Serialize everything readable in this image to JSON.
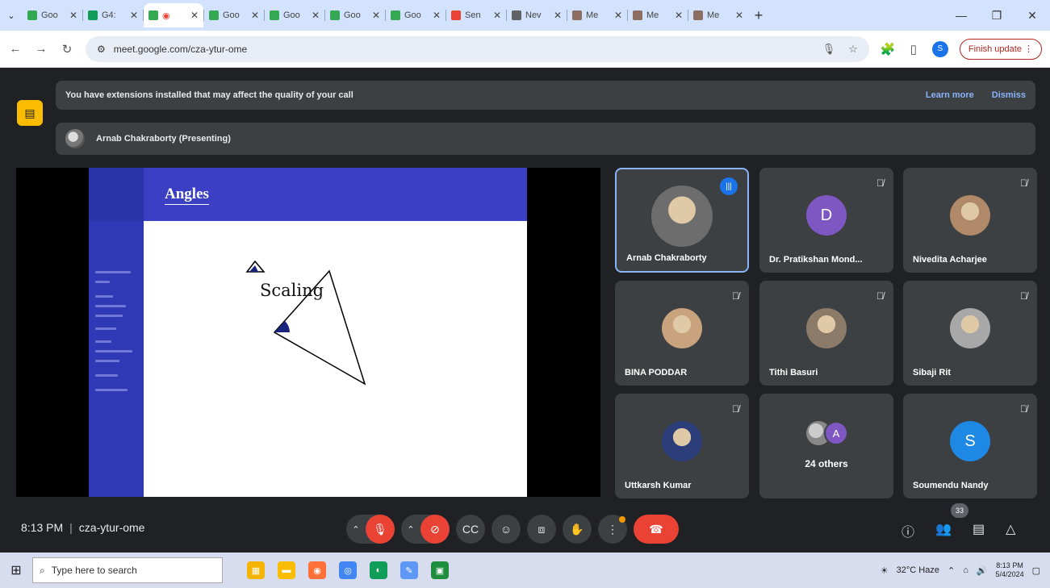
{
  "browser": {
    "tabs": [
      {
        "label": "Goo",
        "color": "#34a853"
      },
      {
        "label": "G4:",
        "color": "#0f9d58"
      },
      {
        "label": "",
        "color": "#34a853",
        "active": true,
        "recording": true
      },
      {
        "label": "Goo",
        "color": "#34a853"
      },
      {
        "label": "Goo",
        "color": "#34a853"
      },
      {
        "label": "Goo",
        "color": "#34a853"
      },
      {
        "label": "Goo",
        "color": "#34a853"
      },
      {
        "label": "Sen",
        "color": "#ea4335"
      },
      {
        "label": "Nev",
        "color": "#5f6368"
      },
      {
        "label": "Me",
        "color": "#8d6e63"
      },
      {
        "label": "Me",
        "color": "#8d6e63"
      },
      {
        "label": "Me",
        "color": "#8d6e63"
      }
    ],
    "url": "meet.google.com/cza-ytur-ome",
    "finish_update": "Finish update",
    "profile_initial": "S"
  },
  "meet": {
    "extension_notice": "You have extensions installed that may affect the quality of your call",
    "learn_more": "Learn more",
    "dismiss": "Dismiss",
    "presenter_label": "Arnab Chakraborty (Presenting)",
    "slide": {
      "title": "Angles",
      "caption": "Scaling"
    },
    "participants": [
      {
        "name": "Arnab Chakraborty",
        "speaking": true,
        "avatar": "photo"
      },
      {
        "name": "Dr. Pratikshan Mond...",
        "initial": "D",
        "color": "#7e57c2",
        "muted": true
      },
      {
        "name": "Nivedita Acharjee",
        "muted": true,
        "avatar": "photo"
      },
      {
        "name": "BINA PODDAR",
        "muted": true,
        "avatar": "photo"
      },
      {
        "name": "Tithi Basuri",
        "muted": true,
        "avatar": "photo"
      },
      {
        "name": "Sibaji Rit",
        "muted": true,
        "avatar": "photo"
      },
      {
        "name": "Uttkarsh Kumar",
        "muted": true,
        "avatar": "photo"
      },
      {
        "name": "24 others",
        "others_initial": "A"
      },
      {
        "name": "Soumendu Nandy",
        "initial": "S",
        "color": "#1e88e5",
        "muted": true
      }
    ],
    "time": "8:13 PM",
    "meeting_code": "cza-ytur-ome",
    "participant_count": "33"
  },
  "taskbar": {
    "search_placeholder": "Type here to search",
    "weather": "32°C  Haze",
    "time": "8:13 PM",
    "date": "5/4/2024"
  }
}
